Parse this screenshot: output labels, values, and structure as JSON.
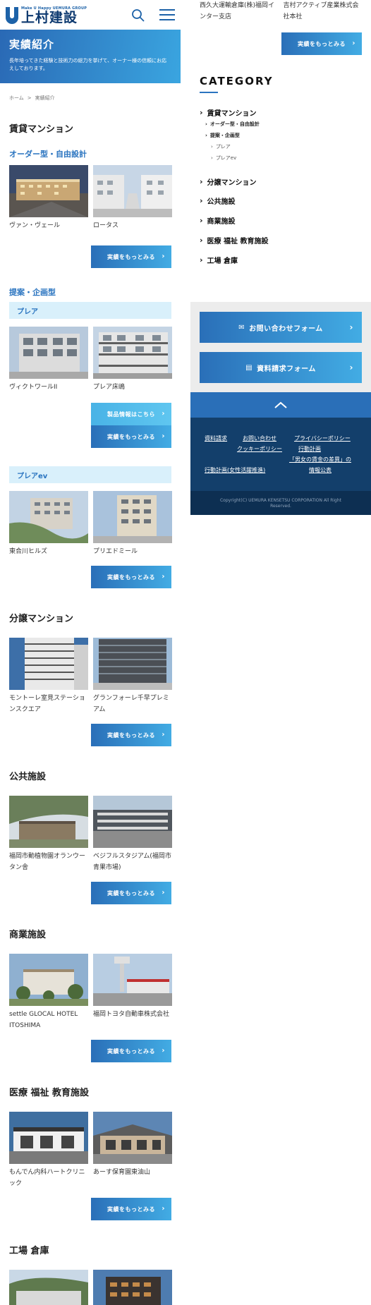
{
  "header": {
    "logo_tagline": "Make U Happy  UEMURA GROUP",
    "logo_name": "上村建設"
  },
  "hero": {
    "title": "実績紹介",
    "description": "長年培ってきた経験と技術力の総力を挙げて、オーナー様の信頼にお応えしております。"
  },
  "breadcrumb": {
    "home": "ホーム",
    "separator": ">",
    "current": "実績紹介"
  },
  "labels": {
    "more": "実績をもっとみる",
    "product_info": "製品情報はこちら"
  },
  "sections": {
    "rental": {
      "title": "賃貸マンション",
      "order_title": "オーダー型・自由設計",
      "order_cards": [
        "ヴァン・ヴェール",
        "ロータス"
      ],
      "plan_title": "提案・企画型",
      "plea_band": "プレア",
      "plea_cards": [
        "ヴィクトワールII",
        "プレア床嶋"
      ],
      "pleaev_band": "プレアev",
      "pleaev_cards": [
        "東合川ヒルズ",
        "プリエドミール"
      ]
    },
    "condo": {
      "title": "分譲マンション",
      "cards": [
        "モントーレ室見ステーションスクエア",
        "グランフォーレ千早プレミアム"
      ]
    },
    "public": {
      "title": "公共施設",
      "cards": [
        "福岡市動植物園オランウータン舎",
        "ベジフルスタジアム(福岡市青果市場)"
      ]
    },
    "commercial": {
      "title": "商業施設",
      "cards": [
        "settle GLOCAL HOTEL ITOSHIMA",
        "福岡トヨタ自動車株式会社"
      ]
    },
    "medical": {
      "title": "医療 福祉 教育施設",
      "cards": [
        "もんでん内科ハートクリニック",
        "あーす保育園東油山"
      ]
    },
    "factory": {
      "title": "工場 倉庫"
    }
  },
  "right_top_cards": [
    "西久大運輸倉庫(株)福岡インター支店",
    "吉村アクティブ産業株式会社本社"
  ],
  "category": {
    "heading": "CATEGORY",
    "items": {
      "rental": "賃貸マンション",
      "order": "オーダー型・自由設計",
      "plan": "提案・企画型",
      "plea": "プレア",
      "pleaev": "プレアev",
      "condo": "分譲マンション",
      "public": "公共施設",
      "commercial": "商業施設",
      "medical": "医療 福祉 教育施設",
      "factory": "工場 倉庫"
    }
  },
  "forms": {
    "contact": "お問い合わせフォーム",
    "request": "資料請求フォーム"
  },
  "footer": {
    "links": {
      "request": "資料請求",
      "contact": "お問い合わせ",
      "privacy": "プライバシーポリシー",
      "cookie": "クッキーポリシー",
      "action_plan": "行動計画",
      "women_plan": "行動計画(女性活躍推進)",
      "wage_gap_1": "「男女の賃金の差異」の",
      "wage_gap_2": "情報公表"
    },
    "copyright_1": "Copyright(C) UEMURA KENSETSU CORPORATION All Right",
    "copyright_2": "Reserved."
  },
  "colors": {
    "brand_blue": "#2a6fb8",
    "accent_blue": "#42ace4",
    "band_bg": "#d9f0fb",
    "footer_bg": "#133f6b"
  }
}
